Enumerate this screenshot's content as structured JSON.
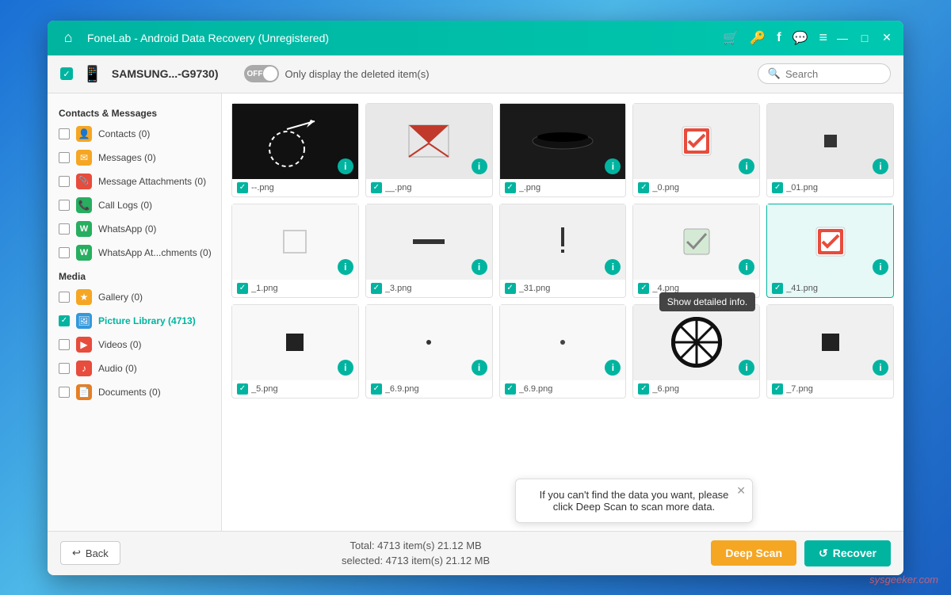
{
  "titleBar": {
    "title": "FoneLab - Android Data Recovery (Unregistered)",
    "homeIcon": "⌂",
    "icons": [
      "🛒",
      "🔑",
      "f",
      "💬",
      "≡"
    ],
    "controls": [
      "—",
      "□",
      "✕"
    ]
  },
  "subHeader": {
    "deviceName": "SAMSUNG...-G9730)",
    "toggleLabel": "OFF",
    "toggleText": "Only display the deleted item(s)",
    "searchPlaceholder": "Search"
  },
  "sidebar": {
    "sections": [
      {
        "title": "Contacts & Messages",
        "items": [
          {
            "label": "Contacts (0)",
            "color": "#f5a623",
            "icon": "👤",
            "checked": false
          },
          {
            "label": "Messages (0)",
            "color": "#f5a623",
            "icon": "✉",
            "checked": false
          },
          {
            "label": "Message Attachments (0)",
            "color": "#e74c3c",
            "icon": "📎",
            "checked": false
          },
          {
            "label": "Call Logs (0)",
            "color": "#27ae60",
            "icon": "📞",
            "checked": false
          },
          {
            "label": "WhatsApp (0)",
            "color": "#27ae60",
            "icon": "W",
            "checked": false
          },
          {
            "label": "WhatsApp At...chments (0)",
            "color": "#27ae60",
            "icon": "W",
            "checked": false
          }
        ]
      },
      {
        "title": "Media",
        "items": [
          {
            "label": "Gallery (0)",
            "color": "#f5a623",
            "icon": "★",
            "checked": false
          },
          {
            "label": "Picture Library (4713)",
            "color": "#3498db",
            "icon": "🖼",
            "checked": true,
            "active": true
          },
          {
            "label": "Videos (0)",
            "color": "#e74c3c",
            "icon": "▶",
            "checked": false
          },
          {
            "label": "Audio (0)",
            "color": "#e74c3c",
            "icon": "♪",
            "checked": false
          },
          {
            "label": "Documents (0)",
            "color": "#e67e22",
            "icon": "📄",
            "checked": false
          }
        ]
      }
    ]
  },
  "images": [
    {
      "filename": "--.png",
      "selected": false,
      "thumb": "arrow"
    },
    {
      "filename": "__.png",
      "selected": false,
      "thumb": "envelope"
    },
    {
      "filename": "_.png",
      "selected": false,
      "thumb": "smile"
    },
    {
      "filename": "_0.png",
      "selected": false,
      "thumb": "checkbox-red"
    },
    {
      "filename": "_01.png",
      "selected": false,
      "thumb": "small-square"
    },
    {
      "filename": "_1.png",
      "selected": false,
      "thumb": "white-box"
    },
    {
      "filename": "_3.png",
      "selected": false,
      "thumb": "minus"
    },
    {
      "filename": "_31.png",
      "selected": false,
      "thumb": "exclaim"
    },
    {
      "filename": "_4.png",
      "selected": false,
      "thumb": "check-light"
    },
    {
      "filename": "_41.png",
      "selected": true,
      "thumb": "checkbox-red2"
    },
    {
      "filename": "_5.png",
      "selected": false,
      "thumb": "black-square"
    },
    {
      "filename": "_6.9.png",
      "selected": false,
      "thumb": "dot"
    },
    {
      "filename": "_6.9.png",
      "selected": false,
      "thumb": "dot2"
    },
    {
      "filename": "_6.png",
      "selected": false,
      "thumb": "circle-x"
    },
    {
      "filename": "_7.png",
      "selected": false,
      "thumb": "black-sq2"
    }
  ],
  "tooltip": {
    "text": "Show detailed info."
  },
  "bottomBar": {
    "backLabel": "Back",
    "totalText": "Total: 4713 item(s) 21.12 MB",
    "selectedText": "selected: 4713 item(s) 21.12 MB",
    "deepScanLabel": "Deep Scan",
    "recoverLabel": "Recover",
    "recoverIcon": "↺"
  },
  "popup": {
    "text": "If you can't find the data you want, please click Deep Scan to scan more data."
  }
}
